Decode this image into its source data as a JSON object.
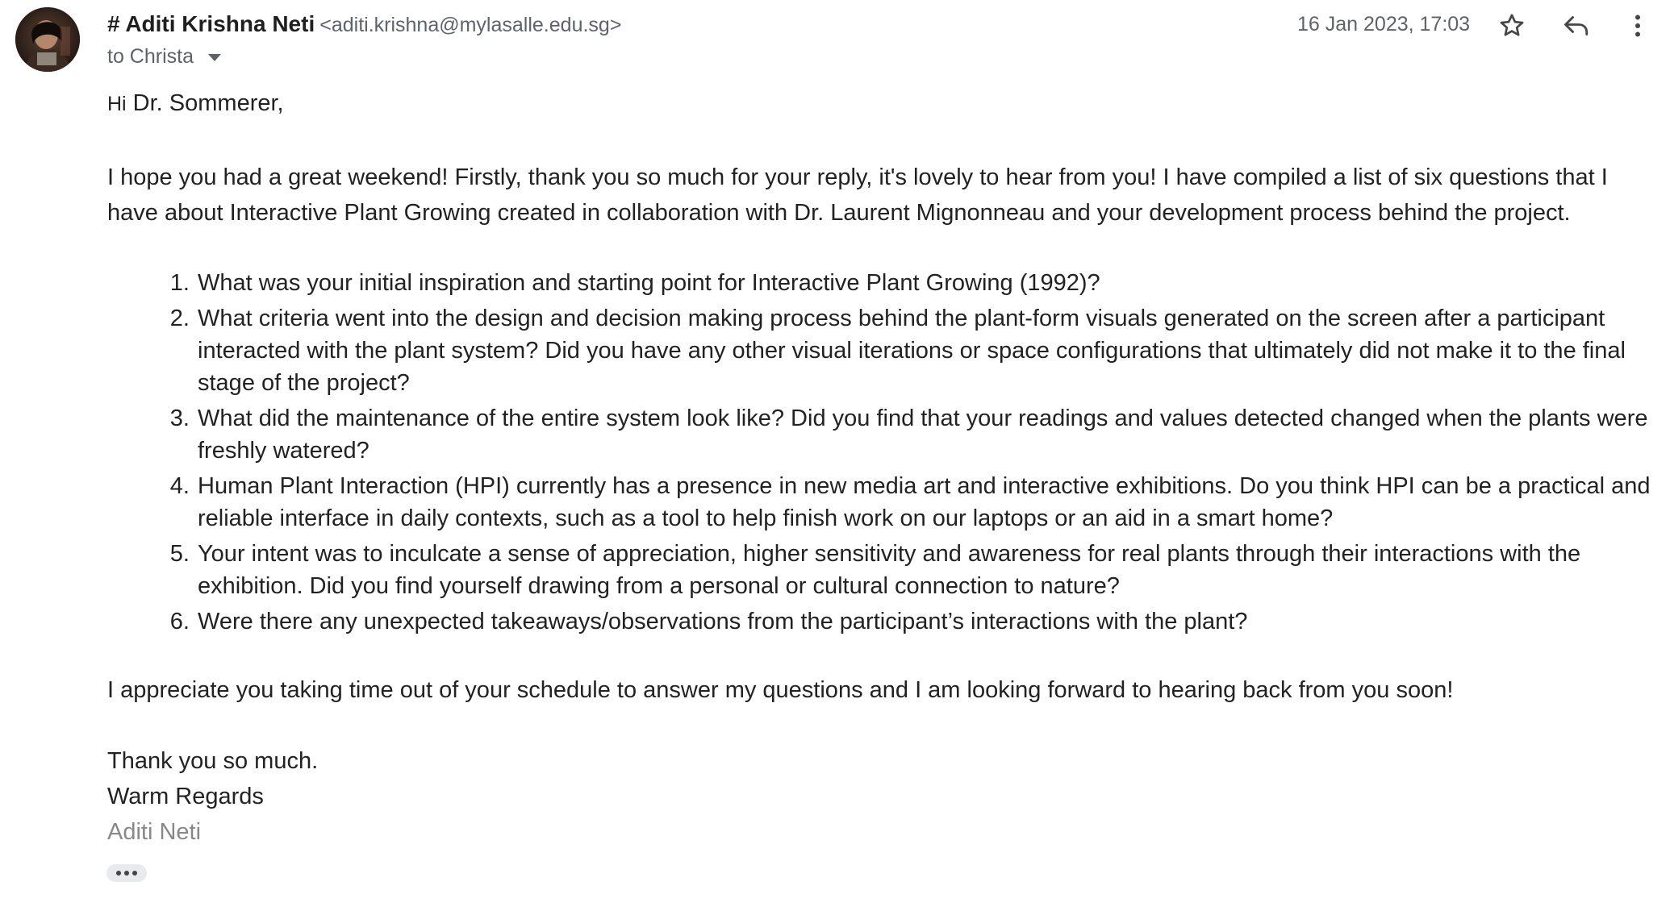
{
  "email": {
    "sender": {
      "name": "# Aditi Krishna Neti",
      "address": "<aditi.krishna@mylasalle.edu.sg>",
      "avatar_icon": "avatar-photo"
    },
    "recipient_label": "to Christa",
    "timestamp": "16 Jan 2023, 17:03",
    "actions": {
      "star_icon": "star-icon",
      "reply_icon": "reply-icon",
      "more_icon": "more-vertical-icon"
    },
    "body": {
      "greeting_hi": "Hi",
      "greeting_name": "Dr. Sommerer,",
      "intro": "I hope you had a great weekend! Firstly, thank you so much for your reply, it's lovely to hear from you! I have compiled a list of six questions that I have about Interactive Plant Growing created in collaboration with Dr. Laurent Mignonneau and your development process behind the project.",
      "questions": [
        "What was your initial inspiration and starting point for Interactive Plant Growing (1992)?",
        "What criteria went into the design and decision making process behind the plant-form visuals generated on the screen after a participant interacted with the plant system? Did you have any other visual iterations or space configurations that ultimately did not make it to the final stage of the project?",
        "What did the maintenance of the entire system look like? Did you find that your readings and values detected changed when the plants were freshly watered?",
        "Human Plant Interaction (HPI) currently has a presence in new media art and interactive exhibitions. Do you think HPI can be a practical and reliable interface in daily contexts, such as a tool to help finish work on our laptops or an aid in a smart home?",
        "Your intent was to inculcate a sense of appreciation, higher sensitivity and awareness for real plants through their interactions with the exhibition. Did you find yourself drawing from a personal or cultural connection to nature?",
        "Were there any unexpected takeaways/observations from the participant’s interactions with the plant?"
      ],
      "closing": "I appreciate you taking time out of your schedule to answer my questions and I am looking forward to hearing back from you soon!",
      "thanks": "Thank you so much.",
      "regards": "Warm Regards",
      "signature": "Aditi Neti"
    },
    "show_trimmed_icon": "ellipsis-icon"
  },
  "colors": {
    "secondary_text": "#5f6368",
    "body_text": "#222222",
    "signature_text": "#888888",
    "chip_background": "#e8eaed"
  }
}
